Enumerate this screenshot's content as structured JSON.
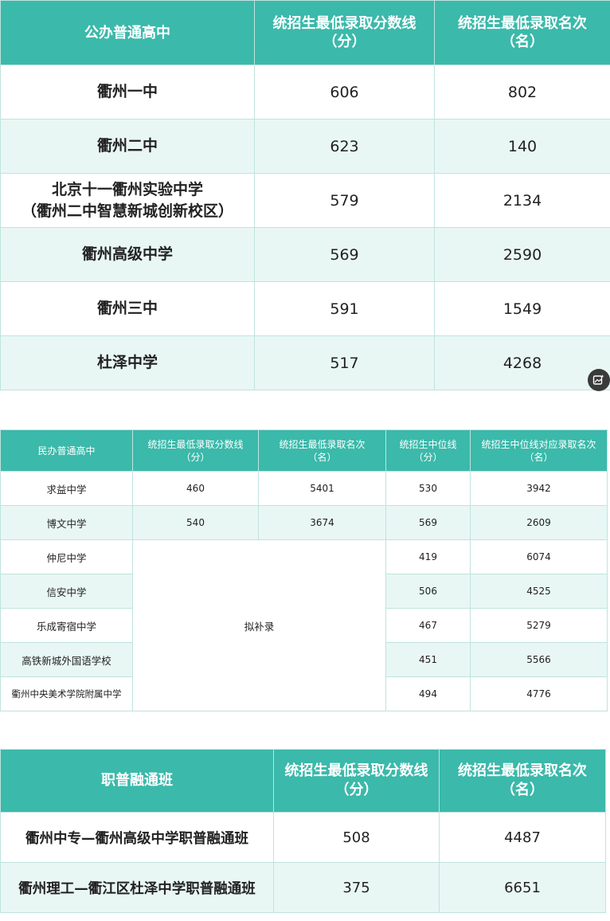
{
  "public": {
    "headers": [
      "公办普通高中",
      "统招生最低录取分数线",
      "（分）",
      "统招生最低录取名次",
      "（名）"
    ],
    "rows": [
      {
        "school": "衢州一中",
        "school2": "",
        "score": "606",
        "rank": "802"
      },
      {
        "school": "衢州二中",
        "school2": "",
        "score": "623",
        "rank": "140"
      },
      {
        "school": "北京十一衢州实验中学",
        "school2": "（衢州二中智慧新城创新校区）",
        "score": "579",
        "rank": "2134"
      },
      {
        "school": "衢州高级中学",
        "school2": "",
        "score": "569",
        "rank": "2590"
      },
      {
        "school": "衢州三中",
        "school2": "",
        "score": "591",
        "rank": "1549"
      },
      {
        "school": "杜泽中学",
        "school2": "",
        "score": "517",
        "rank": "4268"
      }
    ]
  },
  "private": {
    "headers": [
      "民办普通高中",
      "统招生最低录取分数线",
      "（分）",
      "统招生最低录取名次",
      "（名）",
      "统招生中位线",
      "（分）",
      "统招生中位线对应录取名次",
      "（名）"
    ],
    "rows": [
      {
        "school": "求益中学",
        "score": "460",
        "rank": "5401",
        "median": "530",
        "median_rank": "3942"
      },
      {
        "school": "博文中学",
        "score": "540",
        "rank": "3674",
        "median": "569",
        "median_rank": "2609"
      },
      {
        "school": "仲尼中学",
        "median": "419",
        "median_rank": "6074"
      },
      {
        "school": "信安中学",
        "median": "506",
        "median_rank": "4525"
      },
      {
        "school": "乐成寄宿中学",
        "median": "467",
        "median_rank": "5279"
      },
      {
        "school": "高铁新城外国语学校",
        "median": "451",
        "median_rank": "5566"
      },
      {
        "school": "衢州中央美术学院附属中学",
        "median": "494",
        "median_rank": "4776"
      }
    ],
    "merged_note": "拟补录"
  },
  "vocational": {
    "headers": [
      "职普融通班",
      "统招生最低录取分数线",
      "（分）",
      "统招生最低录取名次",
      "（名）"
    ],
    "rows": [
      {
        "school": "衢州中专—衢州高级中学职普融通班",
        "score": "508",
        "rank": "4487"
      },
      {
        "school": "衢州理工—衢江区杜泽中学职普融通班",
        "score": "375",
        "rank": "6651"
      }
    ]
  },
  "icons": {
    "floating_button": "image-edit-icon"
  },
  "colors": {
    "header_bg": "#3bb9aa",
    "stripe_bg": "#e9f7f4",
    "border": "#bfe3de"
  }
}
